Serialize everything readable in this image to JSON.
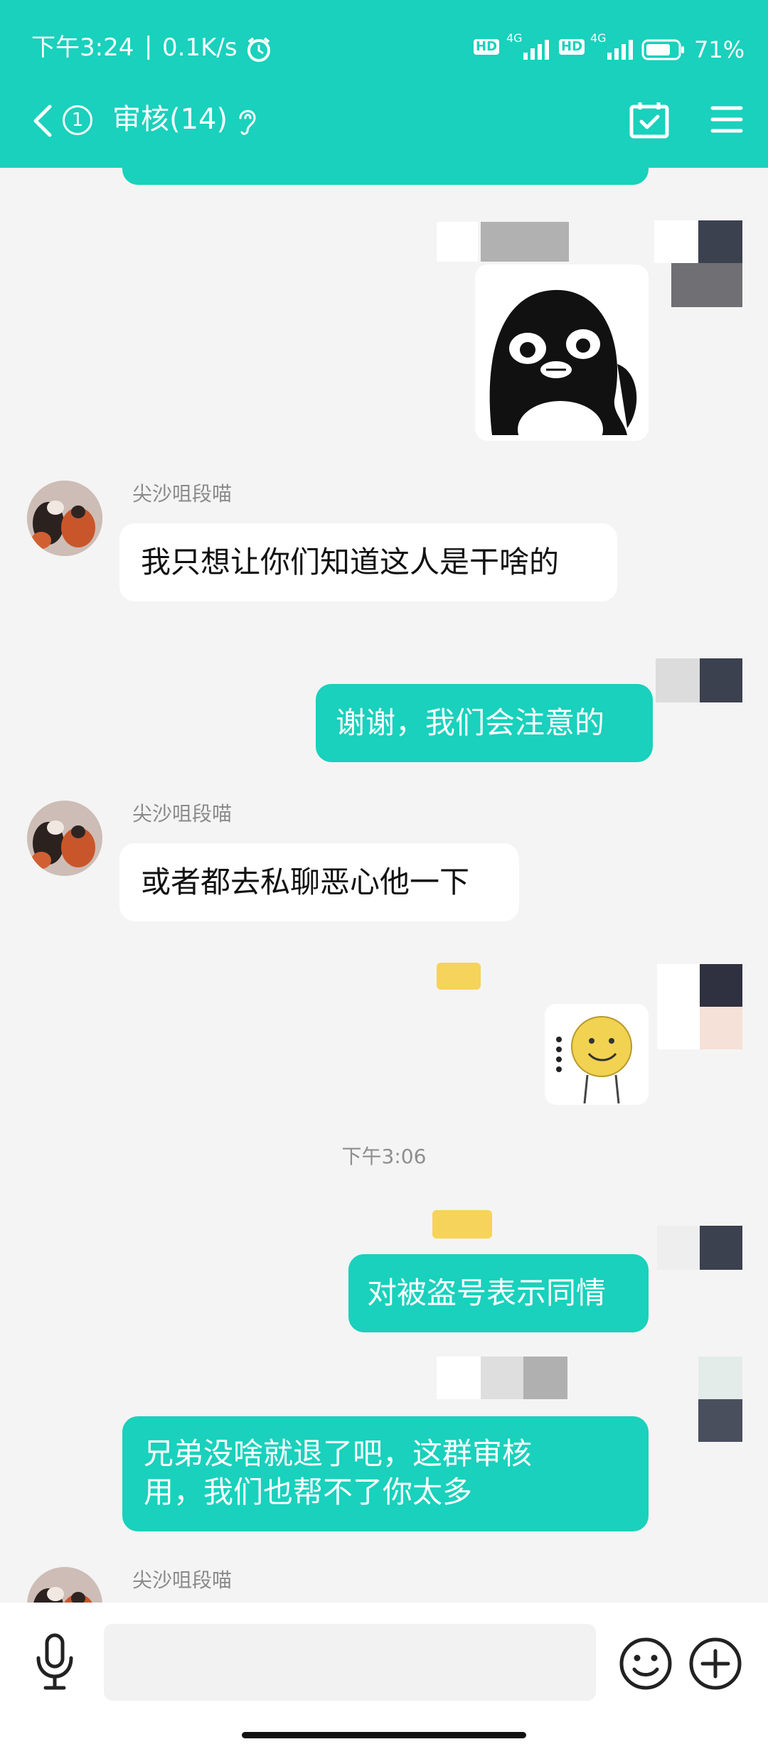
{
  "status": {
    "time": "下午3:24",
    "separator": "|",
    "speed": "0.1K/s",
    "hd1": "HD",
    "net1": "4G",
    "hd2": "HD",
    "net2": "4G",
    "battery": "71%"
  },
  "header": {
    "back_badge": "1",
    "title": "审核(14)"
  },
  "messages": [
    {
      "side": "right",
      "type": "sticker",
      "sticker": "penguin"
    },
    {
      "side": "left",
      "sender": "尖沙咀段喵",
      "text": "我只想让你们知道这人是干啥的"
    },
    {
      "side": "right",
      "text": "谢谢，我们会注意的"
    },
    {
      "side": "left",
      "sender": "尖沙咀段喵",
      "text": "或者都去私聊恶心他一下"
    },
    {
      "side": "right",
      "type": "sticker",
      "sticker": "smiley"
    },
    {
      "type": "time",
      "text": "下午3:06"
    },
    {
      "side": "right",
      "text": "对被盗号表示同情"
    },
    {
      "side": "right",
      "text": "兄弟没啥就退了吧，这群审核用，我们也帮不了你太多"
    },
    {
      "side": "left",
      "sender": "尖沙咀段喵"
    }
  ],
  "msg_lines": {
    "m8_line1": "兄弟没啥就退了吧，这群审核",
    "m8_line2": "用，我们也帮不了你太多"
  },
  "input": {
    "placeholder": ""
  },
  "colors": {
    "accent": "#19d1bc",
    "background": "#f4f4f4",
    "bubble_left": "#ffffff"
  },
  "icons": [
    "back-icon",
    "listen-icon",
    "alarm-icon",
    "signal-icon",
    "battery-icon",
    "calendar-check-icon",
    "menu-icon",
    "microphone-icon",
    "emoji-icon",
    "plus-icon"
  ]
}
